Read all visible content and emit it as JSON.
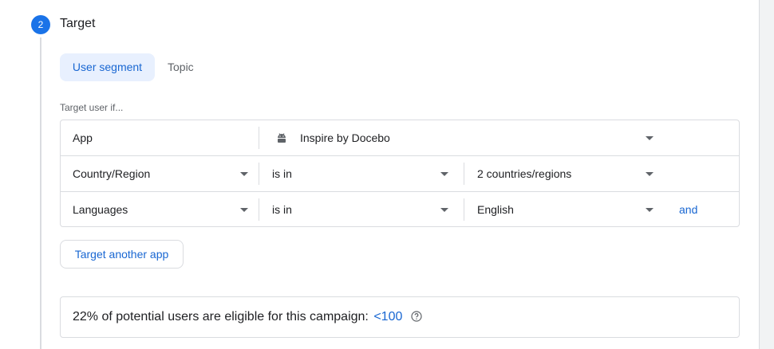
{
  "step": {
    "number": "2",
    "title": "Target"
  },
  "tabs": [
    {
      "label": "User segment",
      "active": true
    },
    {
      "label": "Topic",
      "active": false
    }
  ],
  "target_label": "Target user if...",
  "conditions": [
    {
      "field": "App",
      "value": "Inspire by Docebo",
      "value_icon": "android-icon"
    },
    {
      "field": "Country/Region",
      "operator": "is in",
      "value": "2 countries/regions"
    },
    {
      "field": "Languages",
      "operator": "is in",
      "value": "English",
      "connector": "and"
    }
  ],
  "target_another_app_label": "Target another app",
  "eligibility": {
    "text": "22% of potential users are eligible for this campaign:",
    "value": "<100",
    "help_icon": "help-circle-icon"
  },
  "colors": {
    "accent": "#1a73e8",
    "link": "#1967d2",
    "tab_active_bg": "#e8f0fe",
    "border": "#dadce0"
  }
}
